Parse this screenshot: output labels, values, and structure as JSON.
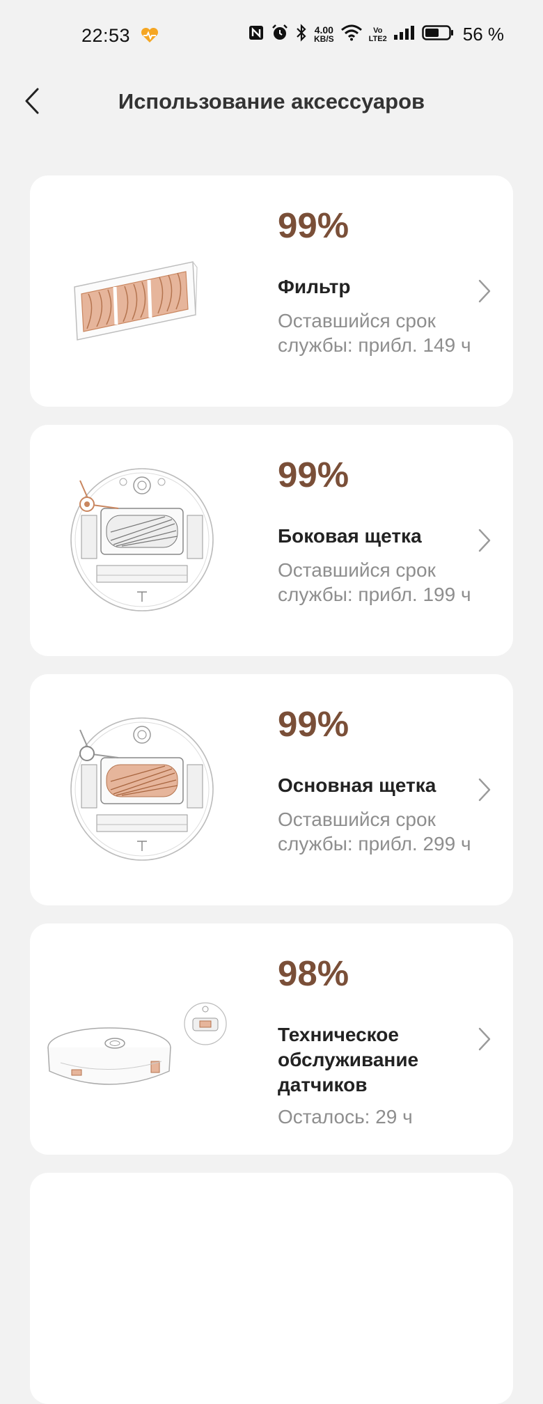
{
  "status_bar": {
    "time": "22:53",
    "speed_value": "4.00",
    "speed_unit": "KB/S",
    "volte_top": "Vo",
    "volte_bottom": "LTE2",
    "battery_percent": "56 %"
  },
  "header": {
    "title": "Использование аксессуаров"
  },
  "accessories": [
    {
      "percent": "99%",
      "name": "Фильтр",
      "remaining": "Оставшийся срок службы: прибл. 149 ч",
      "image": "filter-image"
    },
    {
      "percent": "99%",
      "name": "Боковая щетка",
      "remaining": "Оставшийся срок службы: прибл. 199 ч",
      "image": "side-brush-image"
    },
    {
      "percent": "99%",
      "name": "Основная щетка",
      "remaining": "Оставшийся срок службы: прибл. 299 ч",
      "image": "main-brush-image"
    },
    {
      "percent": "98%",
      "name": "Техническое обслуживание датчиков",
      "remaining": "Осталось: 29 ч",
      "image": "sensor-image"
    }
  ],
  "colors": {
    "accent_percent": "#7a4f38",
    "background": "#f2f2f2",
    "card": "#ffffff",
    "secondary_text": "#8e8e8e"
  }
}
